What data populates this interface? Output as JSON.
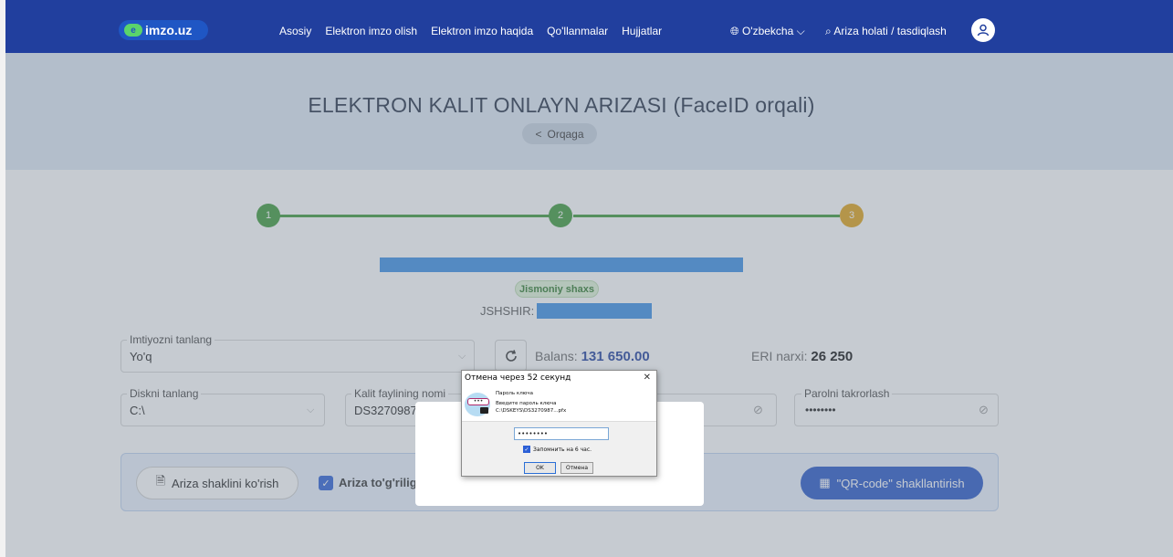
{
  "nav": {
    "logo_text": "imzo.uz",
    "links": [
      "Asosiy",
      "Elektron imzo olish",
      "Elektron imzo haqida",
      "Qo'llanmalar",
      "Hujjatlar"
    ],
    "language": "O'zbekcha",
    "search_label": "Ariza holati / tasdiqlash"
  },
  "hero": {
    "title": "ELEKTRON KALIT ONLAYN ARIZASI (FaceID orqali)",
    "back_label": "Orqaga"
  },
  "steps": [
    "1",
    "2",
    "3"
  ],
  "person": {
    "type_badge": "Jismoniy shaxs",
    "jshshir_label": "JSHSHIR:"
  },
  "form": {
    "privilege_label": "Imtiyozni tanlang",
    "privilege_value": "Yo'q",
    "balance_label": "Balans:",
    "balance_value": "131 650.00",
    "price_label": "ERI narxi:",
    "price_value": "26 250",
    "disk_label": "Diskni tanlang",
    "disk_value": "C:\\",
    "keyfile_label": "Kalit faylining nomi",
    "keyfile_value": "DS3270987",
    "password_repeat_label": "Parolni takrorlash",
    "password_repeat_value": "••••••••"
  },
  "actions": {
    "view_form": "Ariza shaklini ko'rish",
    "confirm_checkbox": "Ariza to'g'riligi",
    "qr_button": "\"QR-code\" shakllantirish"
  },
  "dialog": {
    "title": "Отмена через 52 секунд",
    "header": "Пароль ключа",
    "prompt": "Введите пароль ключа",
    "path": "C:\\DSKEYS\\DS3270987...pfx",
    "password_value": "••••••••",
    "remember_label": "Запомнить на 6 час.",
    "ok_label": "OK",
    "cancel_label": "Отмена"
  },
  "colors": {
    "nav_bg": "#213f9e",
    "step_done": "#3d9939",
    "step_active": "#e0a317",
    "primary": "#2756c9",
    "redaction": "#3c8fe6"
  }
}
